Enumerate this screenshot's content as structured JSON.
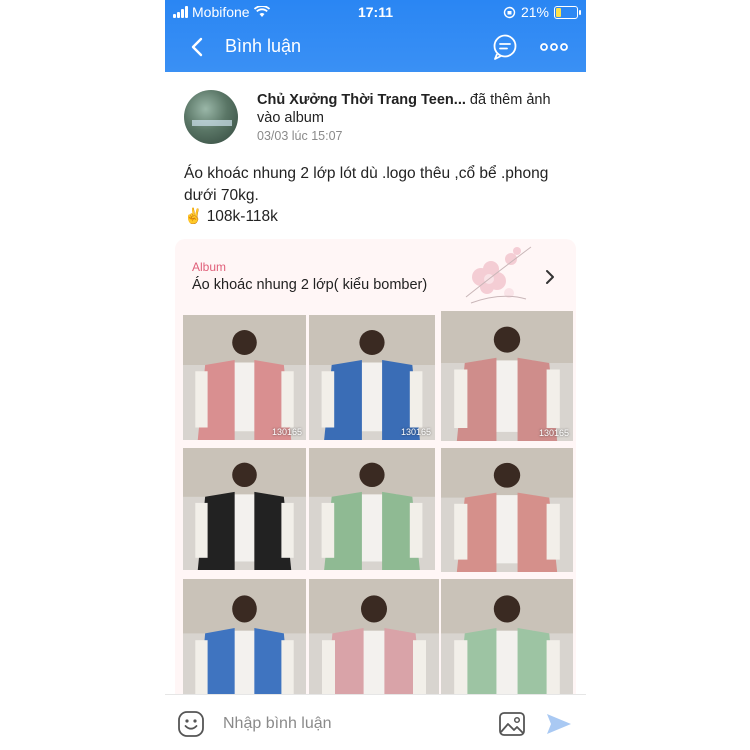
{
  "status": {
    "carrier": "Mobifone",
    "time": "17:11",
    "battery": "21%"
  },
  "header": {
    "title": "Bình luận",
    "back_icon": "chevron-left-icon",
    "chat_icon": "chat-bubble-icon",
    "more_icon": "more-dots-icon"
  },
  "post": {
    "author_name": "Chủ Xưởng Thời Trang Teen...",
    "action": " đã thêm ảnh vào album",
    "date": "03/03 lúc 15:07",
    "caption_line1": "Áo khoác nhung 2 lớp lót dù .logo thêu ,cổ bể .phong dưới 70kg.",
    "price_emoji": "✌️",
    "price": "108k-118k"
  },
  "album": {
    "label": "Album",
    "title": "Áo khoác nhung 2 lớp( kiểu bomber)",
    "photos": [
      {
        "color": "#d98f90",
        "code": "130165"
      },
      {
        "color": "#3a6db6",
        "code": "130165"
      },
      {
        "color": "#cf8d8b",
        "code": "130165"
      },
      {
        "color": "#222222",
        "code": ""
      },
      {
        "color": "#8fba93",
        "code": ""
      },
      {
        "color": "#d5908b",
        "code": ""
      },
      {
        "color": "#3f74c0",
        "code": ""
      },
      {
        "color": "#d9a3a8",
        "code": ""
      },
      {
        "color": "#9dc4a3",
        "code": ""
      }
    ]
  },
  "composer": {
    "placeholder": "Nhập bình luận"
  },
  "colors": {
    "accent": "#2a86f3",
    "album_label": "#e0607a",
    "album_bg": "#fff6f6"
  }
}
